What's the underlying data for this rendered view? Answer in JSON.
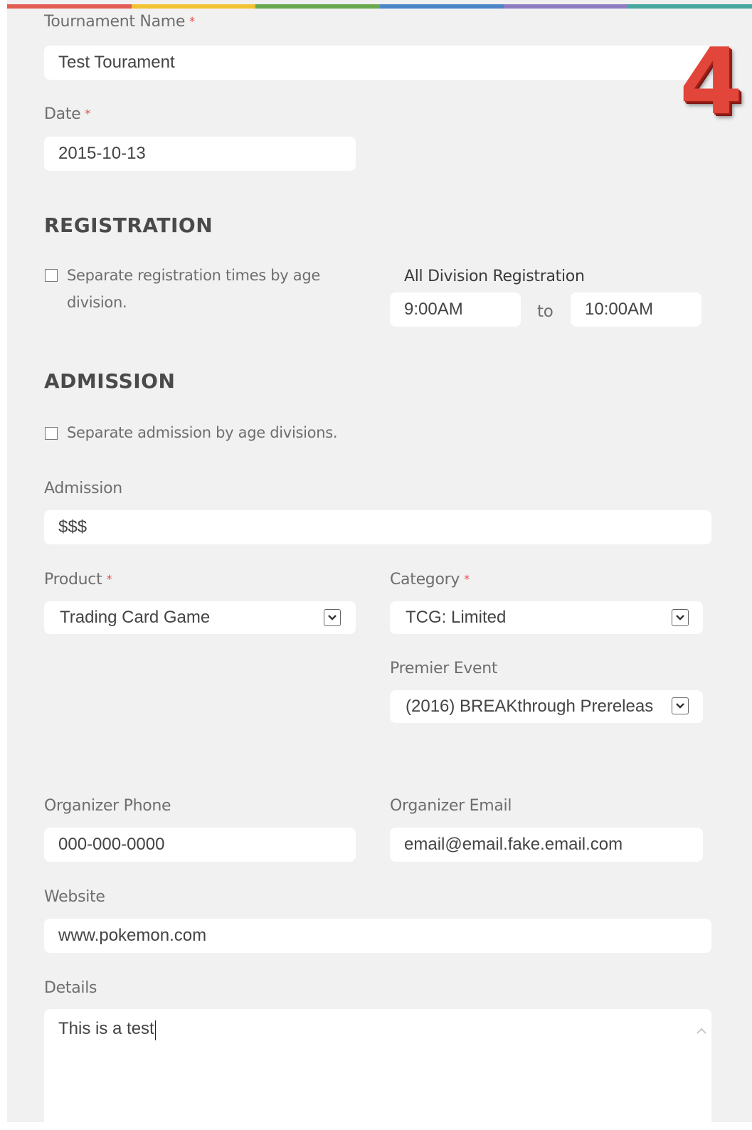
{
  "colors": {
    "panel_bg": "#f1f1f1",
    "field_bg": "#ffffff",
    "required_marker": "#e44b4b",
    "badge": "#e2453a",
    "top_stripe": [
      "#e25d52",
      "#f1c232",
      "#6aa84f",
      "#4a86c5",
      "#8e7cc3",
      "#45a7a0"
    ]
  },
  "badge_number": "4",
  "tournament": {
    "name_label": "Tournament Name",
    "name_value": "Test Tourament",
    "date_label": "Date",
    "date_value": "2015-10-13"
  },
  "registration": {
    "heading": "REGISTRATION",
    "separate_label_line1": "Separate registration times by age",
    "separate_label_line2": "division.",
    "all_division_label": "All Division Registration",
    "start_time": "9:00AM",
    "to_label": "to",
    "end_time": "10:00AM"
  },
  "admission": {
    "heading": "ADMISSION",
    "separate_label": "Separate admission by age divisions.",
    "admission_label": "Admission",
    "admission_value": "$$$"
  },
  "product": {
    "label": "Product",
    "value": "Trading Card Game"
  },
  "category": {
    "label": "Category",
    "value": "TCG: Limited"
  },
  "premier": {
    "label": "Premier Event",
    "value": "(2016) BREAKthrough Prereleas"
  },
  "organizer": {
    "phone_label": "Organizer Phone",
    "phone_value": "000-000-0000",
    "email_label": "Organizer Email",
    "email_value": "email@email.fake.email.com"
  },
  "website": {
    "label": "Website",
    "value": "www.pokemon.com"
  },
  "details": {
    "label": "Details",
    "value": "This is a test"
  },
  "required_mark": "*"
}
